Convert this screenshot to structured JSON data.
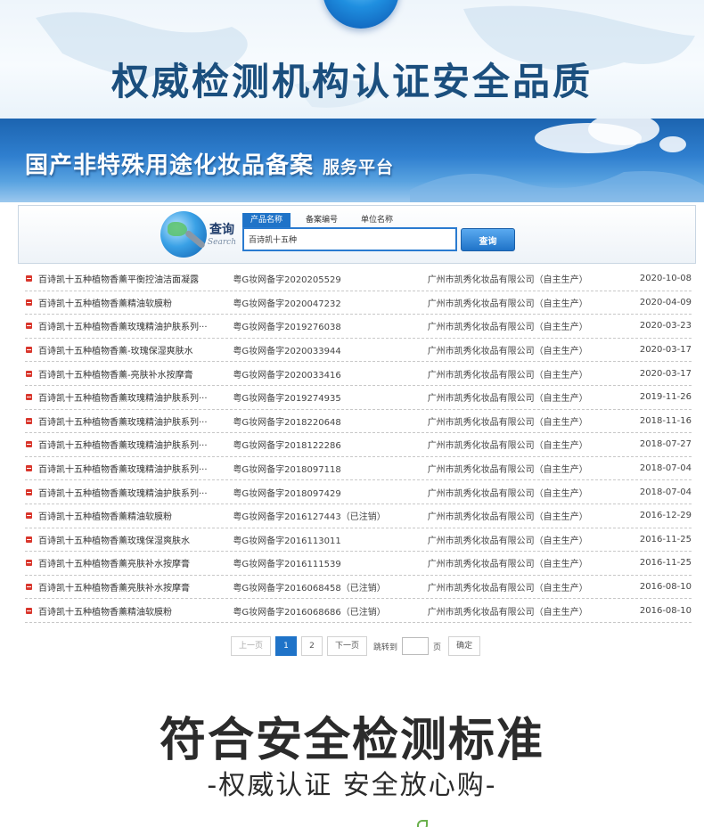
{
  "top_banner": {
    "title": "权威检测机构认证安全品质"
  },
  "platform": {
    "title": "国产非特殊用途化妆品备案",
    "subtitle": "服务平台"
  },
  "search": {
    "label": "查询",
    "label_en": "Search",
    "tabs": [
      "产品名称",
      "备案编号",
      "单位名称"
    ],
    "active_tab": 0,
    "value": "百诗凯十五种",
    "button": "查询"
  },
  "records": [
    {
      "name": "百诗凯十五种植物香薰平衡控油洁面凝露",
      "no": "粤G妆网备字2020205529",
      "company": "广州市凯秀化妆品有限公司（自主生产）",
      "date": "2020-10-08"
    },
    {
      "name": "百诗凯十五种植物香薰精油软膜粉",
      "no": "粤G妆网备字2020047232",
      "company": "广州市凯秀化妆品有限公司（自主生产）",
      "date": "2020-04-09"
    },
    {
      "name": "百诗凯十五种植物香薰玫瑰精油护肤系列···",
      "no": "粤G妆网备字2019276038",
      "company": "广州市凯秀化妆品有限公司（自主生产）",
      "date": "2020-03-23"
    },
    {
      "name": "百诗凯十五种植物香薰-玫瑰保湿爽肤水",
      "no": "粤G妆网备字2020033944",
      "company": "广州市凯秀化妆品有限公司（自主生产）",
      "date": "2020-03-17"
    },
    {
      "name": "百诗凯十五种植物香薰-亮肤补水按摩膏",
      "no": "粤G妆网备字2020033416",
      "company": "广州市凯秀化妆品有限公司（自主生产）",
      "date": "2020-03-17"
    },
    {
      "name": "百诗凯十五种植物香薰玫瑰精油护肤系列···",
      "no": "粤G妆网备字2019274935",
      "company": "广州市凯秀化妆品有限公司（自主生产）",
      "date": "2019-11-26"
    },
    {
      "name": "百诗凯十五种植物香薰玫瑰精油护肤系列···",
      "no": "粤G妆网备字2018220648",
      "company": "广州市凯秀化妆品有限公司（自主生产）",
      "date": "2018-11-16"
    },
    {
      "name": "百诗凯十五种植物香薰玫瑰精油护肤系列···",
      "no": "粤G妆网备字2018122286",
      "company": "广州市凯秀化妆品有限公司（自主生产）",
      "date": "2018-07-27"
    },
    {
      "name": "百诗凯十五种植物香薰玫瑰精油护肤系列···",
      "no": "粤G妆网备字2018097118",
      "company": "广州市凯秀化妆品有限公司（自主生产）",
      "date": "2018-07-04"
    },
    {
      "name": "百诗凯十五种植物香薰玫瑰精油护肤系列···",
      "no": "粤G妆网备字2018097429",
      "company": "广州市凯秀化妆品有限公司（自主生产）",
      "date": "2018-07-04"
    },
    {
      "name": "百诗凯十五种植物香薰精油软膜粉",
      "no": "粤G妆网备字2016127443（已注销）",
      "company": "广州市凯秀化妆品有限公司（自主生产）",
      "date": "2016-12-29"
    },
    {
      "name": "百诗凯十五种植物香薰玫瑰保湿爽肤水",
      "no": "粤G妆网备字2016113011",
      "company": "广州市凯秀化妆品有限公司（自主生产）",
      "date": "2016-11-25"
    },
    {
      "name": "百诗凯十五种植物香薰亮肤补水按摩膏",
      "no": "粤G妆网备字2016111539",
      "company": "广州市凯秀化妆品有限公司（自主生产）",
      "date": "2016-11-25"
    },
    {
      "name": "百诗凯十五种植物香薰亮肤补水按摩膏",
      "no": "粤G妆网备字2016068458（已注销）",
      "company": "广州市凯秀化妆品有限公司（自主生产）",
      "date": "2016-08-10"
    },
    {
      "name": "百诗凯十五种植物香薰精油软膜粉",
      "no": "粤G妆网备字2016068686（已注销）",
      "company": "广州市凯秀化妆品有限公司（自主生产）",
      "date": "2016-08-10"
    }
  ],
  "pager": {
    "prev": "上一页",
    "pages": [
      "1",
      "2"
    ],
    "current": 0,
    "next": "下一页",
    "jump_label": "跳转到",
    "page_unit": "页",
    "confirm": "确定"
  },
  "bottom": {
    "title": "符合安全检测标准",
    "subtitle": "-权威认证 安全放心购-"
  },
  "colors": {
    "accent": "#1f73c8",
    "bullet": "#d9372d",
    "title": "#1b4f7e"
  }
}
